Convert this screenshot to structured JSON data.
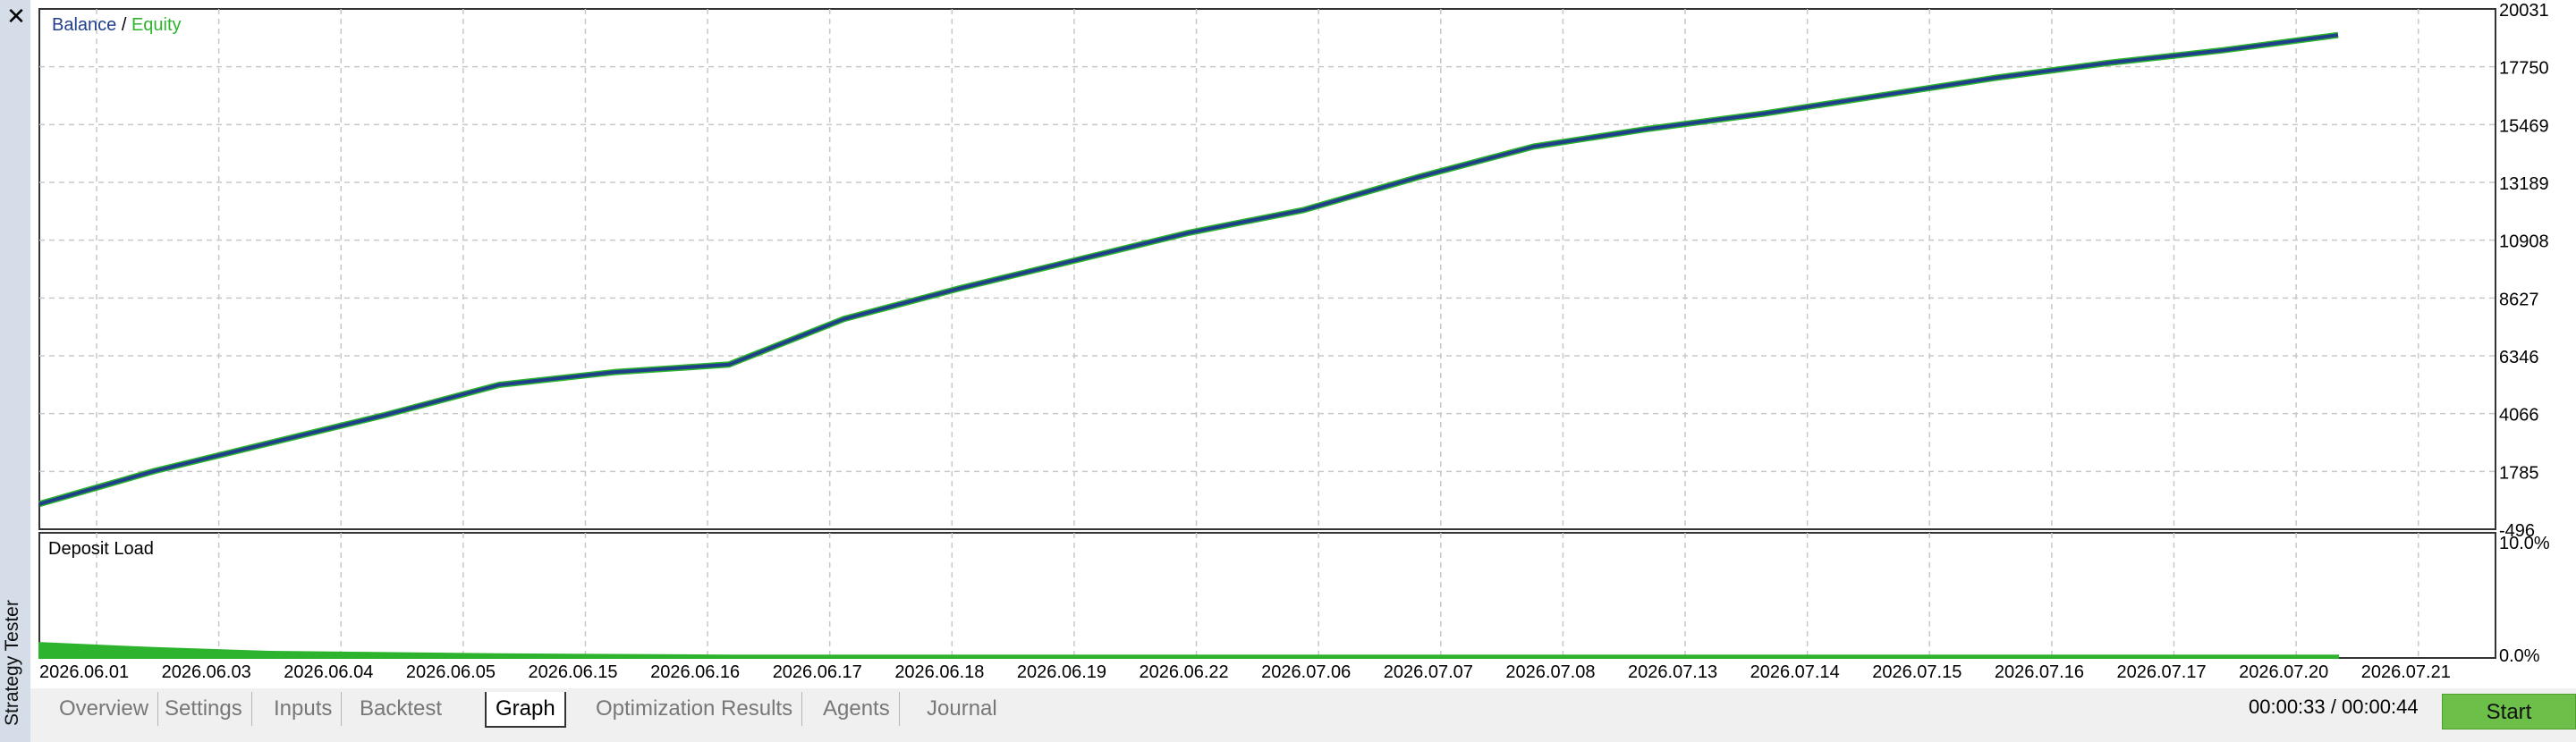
{
  "window": {
    "side_title": "Strategy Tester",
    "close_glyph": "✕"
  },
  "balance_chart": {
    "legend_balance": "Balance",
    "legend_sep": " / ",
    "legend_equity": "Equity"
  },
  "deposit_chart": {
    "title": "Deposit Load"
  },
  "tabs": [
    {
      "label": "Overview"
    },
    {
      "label": "Settings"
    },
    {
      "label": "Inputs"
    },
    {
      "label": "Backtest"
    },
    {
      "label": "Graph",
      "active": true
    },
    {
      "label": "Optimization Results"
    },
    {
      "label": "Agents"
    },
    {
      "label": "Journal"
    }
  ],
  "status": {
    "timer": "00:00:33 / 00:00:44",
    "start_label": "Start"
  },
  "colors": {
    "balance": "#1f3f8c",
    "equity": "#2db32d",
    "grid": "#c8c8c8",
    "start_button": "#6cc04a"
  },
  "chart_data": [
    {
      "type": "line",
      "title": "",
      "legend": [
        "Balance",
        "Equity"
      ],
      "legend_position": "top-left",
      "grid": true,
      "y_axis_side": "right",
      "yticks": [
        -496,
        1785,
        4066,
        6346,
        8627,
        10908,
        13189,
        15469,
        17750,
        20031
      ],
      "ylim": [
        -496,
        20031
      ],
      "x_categories": [
        "2026.06.01",
        "2026.06.03",
        "2026.06.04",
        "2026.06.05",
        "2026.06.15",
        "2026.06.16",
        "2026.06.17",
        "2026.06.18",
        "2026.06.19",
        "2026.06.22",
        "2026.07.06",
        "2026.07.07",
        "2026.07.08",
        "2026.07.13",
        "2026.07.14",
        "2026.07.15",
        "2026.07.16",
        "2026.07.17",
        "2026.07.20",
        "2026.07.21"
      ],
      "series": [
        {
          "name": "Balance",
          "values": [
            500,
            1800,
            2900,
            4000,
            5200,
            5700,
            6000,
            7800,
            9000,
            10100,
            11200,
            12100,
            13400,
            14600,
            15300,
            15900,
            16600,
            17300,
            17900,
            18400,
            19000
          ]
        },
        {
          "name": "Equity",
          "values": [
            500,
            1800,
            2900,
            4000,
            5200,
            5700,
            6000,
            7800,
            9000,
            10100,
            11200,
            12100,
            13400,
            14600,
            15300,
            15900,
            16600,
            17300,
            17900,
            18400,
            19000
          ]
        }
      ]
    },
    {
      "type": "area",
      "title": "Deposit Load",
      "yticks": [
        "0.0%",
        "10.0%"
      ],
      "ylim": [
        0,
        10
      ],
      "series": [
        {
          "values": [
            1.2,
            0.8,
            0.5,
            0.4,
            0.3,
            0.25,
            0.2,
            0.2,
            0.2,
            0.2,
            0.2,
            0.2,
            0.2,
            0.2,
            0.2,
            0.2,
            0.2,
            0.2,
            0.2,
            0.2,
            0.2
          ]
        }
      ]
    }
  ]
}
